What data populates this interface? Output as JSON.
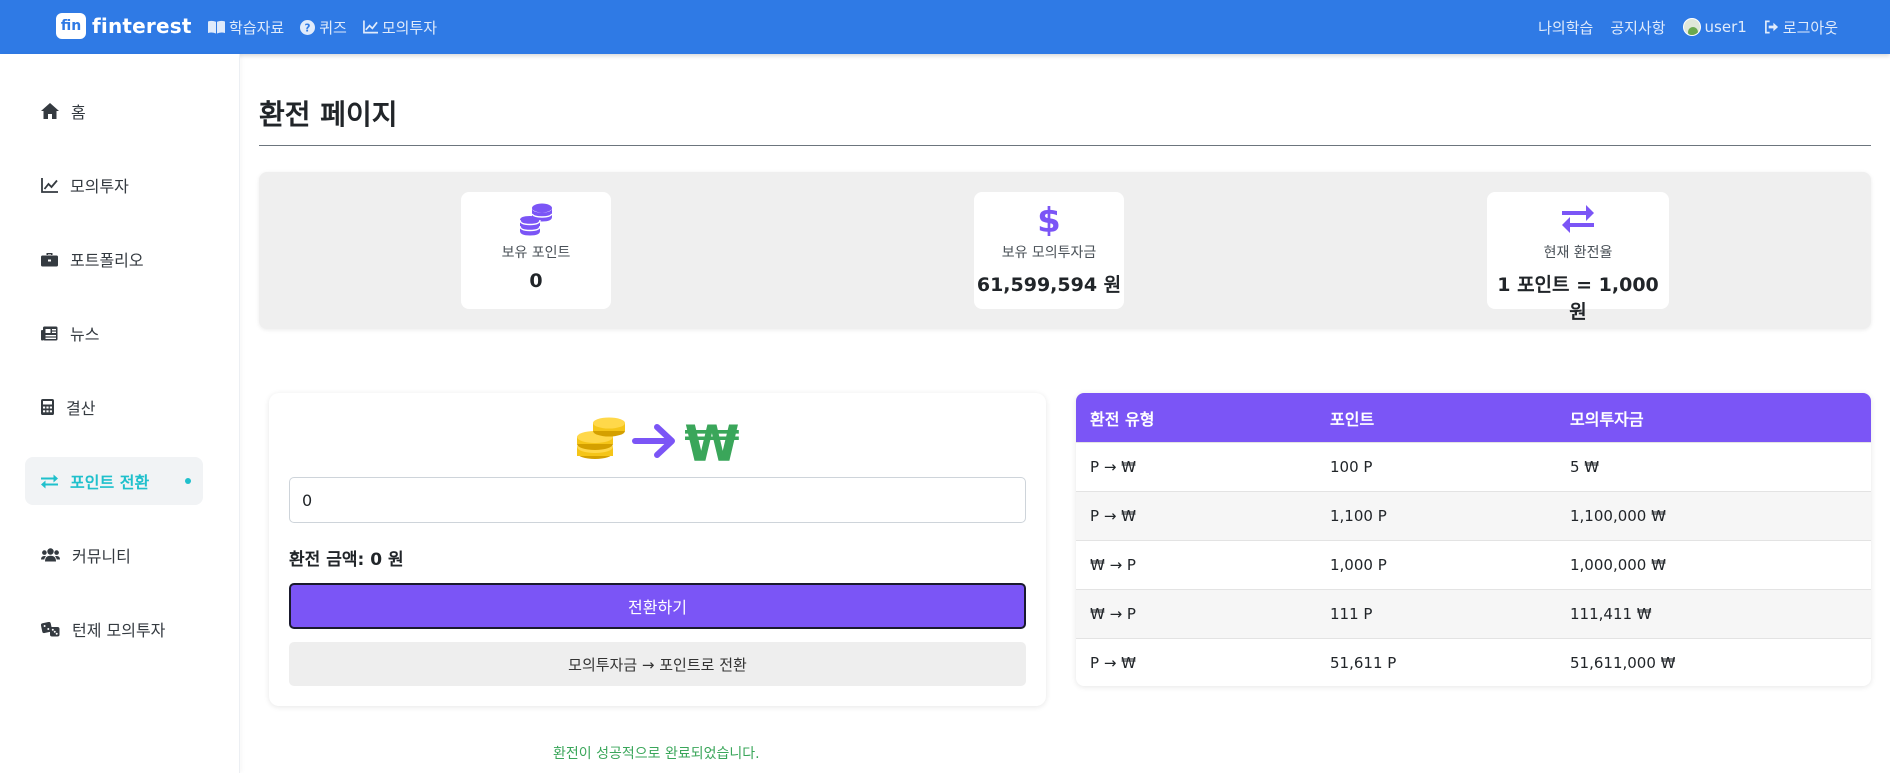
{
  "nav": {
    "logo_mark": "fin",
    "brand": "finterest",
    "left_links": [
      {
        "label": "학습자료",
        "icon": "book-icon"
      },
      {
        "label": "퀴즈",
        "icon": "question-circle-icon"
      },
      {
        "label": "모의투자",
        "icon": "chart-line-icon"
      }
    ],
    "right_links": {
      "my_learning": "나의학습",
      "notice": "공지사항",
      "user": "user1",
      "logout": "로그아웃"
    }
  },
  "sidebar": {
    "items": [
      {
        "label": "홈",
        "icon": "home-icon"
      },
      {
        "label": "모의투자",
        "icon": "chart-line-icon"
      },
      {
        "label": "포트폴리오",
        "icon": "briefcase-icon"
      },
      {
        "label": "뉴스",
        "icon": "newspaper-icon"
      },
      {
        "label": "결산",
        "icon": "calculator-icon"
      },
      {
        "label": "포인트 전환",
        "icon": "exchange-icon",
        "active": true
      },
      {
        "label": "커뮤니티",
        "icon": "users-icon"
      },
      {
        "label": "턴제 모의투자",
        "icon": "dice-icon"
      }
    ]
  },
  "page": {
    "title": "환전 페이지"
  },
  "stats": {
    "points": {
      "label": "보유 포인트",
      "value": "0",
      "icon": "coins-icon"
    },
    "funds": {
      "label": "보유 모의투자금",
      "value": "61,599,594 원",
      "icon": "dollar-icon"
    },
    "rate": {
      "label": "현재 환전율",
      "value": "1 포인트 = 1,000 원",
      "icon": "exchange-icon"
    }
  },
  "exchange": {
    "input_value": "0",
    "amount_text": "환전 금액: 0 원",
    "convert_button": "전환하기",
    "reverse_button": "모의투자금 → 포인트로 전환",
    "success_message": "환전이 성공적으로 완료되었습니다.",
    "colors": {
      "accent": "#7b55f6",
      "coin": "#f5c518",
      "won": "#3aa65a"
    }
  },
  "history": {
    "headers": [
      "환전 유형",
      "포인트",
      "모의투자금"
    ],
    "rows": [
      [
        "P → ₩",
        "100 P",
        "5 ₩"
      ],
      [
        "P → ₩",
        "1,100 P",
        "1,100,000 ₩"
      ],
      [
        "₩ → P",
        "1,000 P",
        "1,000,000 ₩"
      ],
      [
        "₩ → P",
        "111 P",
        "111,411 ₩"
      ],
      [
        "P → ₩",
        "51,611 P",
        "51,611,000 ₩"
      ]
    ]
  }
}
